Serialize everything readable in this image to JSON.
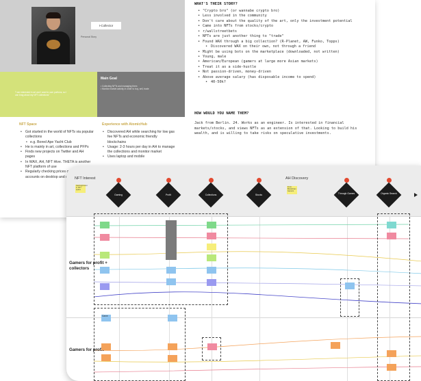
{
  "persona": {
    "name_field": "I-Collector",
    "name_tag": "Personal Story",
    "quote": "\"I am interested in art and I want to own portions, so I can brag about my NFT collections\"",
    "main_goal": {
      "title": "Main Goal",
      "items": [
        "Collecting NFTs and managing them",
        "Monitor market activity in order to buy, sell, trade"
      ]
    },
    "nft_space": {
      "title": "NFT Space",
      "items": [
        {
          "text": "Got started in the world of NFTs via popular collections",
          "sub": false
        },
        {
          "text": "e.g. Bored Ape Yacht Club",
          "sub": true
        },
        {
          "text": "He is mainly in art, collections and PFPs",
          "sub": false
        },
        {
          "text": "Finds new projects on Twitter and AH pages",
          "sub": false
        },
        {
          "text": "In WAX, AH, NFT Hive. THETA is another NFT platform of use",
          "sub": false
        },
        {
          "text": "Regularly checking prices on different accounts on desktop and mobile",
          "sub": false
        }
      ]
    },
    "experience": {
      "title": "Experience with AtomicHub",
      "items": [
        "Discovered AH while searching for low gas fee NFTs and economic friendly blockchains",
        "Usage: 2-3 hours per day in AH to manage the collections and monitor market",
        "Uses laptop and mobile"
      ]
    },
    "story": {
      "title": "WHAT'S THEIR STORY?",
      "items": [
        {
          "text": "\"Crypto bro\" (or wannabe crypto bro)",
          "sub": false
        },
        {
          "text": "Less involved in the community",
          "sub": false
        },
        {
          "text": "Don't care about the quality of the art, only the investment potential",
          "sub": false
        },
        {
          "text": "Came into NFTs from stocks/crypto",
          "sub": false
        },
        {
          "text": "r/wallstreetbets",
          "sub": false
        },
        {
          "text": "NFTs are just another thing to \"trade\"",
          "sub": false
        },
        {
          "text": "Found WAX through a big collection? (R-Planet, AW, Funko, Topps)",
          "sub": false
        },
        {
          "text": "Discovered WAX on their own, not through a friend",
          "sub": true
        },
        {
          "text": "Might be using bots on the marketplace (downloaded, not written)",
          "sub": false
        },
        {
          "text": "Young, male",
          "sub": false
        },
        {
          "text": "American/European (gamers at large more Asian markets)",
          "sub": false
        },
        {
          "text": "Treat it as a side-hustle",
          "sub": false
        },
        {
          "text": "Not passion-driven, money-driven",
          "sub": false
        },
        {
          "text": "Above average salary (has disposable income to spend)",
          "sub": false
        },
        {
          "text": "40-50k?",
          "sub": true
        }
      ]
    },
    "name_question": {
      "title": "HOW WOULD YOU NAME THEM?",
      "text": "Jack from Berlin. 24. Works as an engineer. Is interested in financial markets/stocks, and views NFTs as an extension of that. Looking to build his wealth, and is willing to take risks on speculative investments."
    }
  },
  "board": {
    "header_labels": {
      "nft_interest": "NFT Interest",
      "ah_discovery": "AH Discovery"
    },
    "stages": [
      "Gaming",
      "Profit",
      "Collections",
      "Stocks",
      "Through Games",
      "Organic Search"
    ],
    "sticky_notes": [
      "Gaming/invest in NFT space",
      "From Blockchain Gamers",
      "Nav to something"
    ],
    "rows": [
      "Gamers for profit + collectors",
      "Gamers for profit"
    ],
    "game_label": "Game",
    "sticky_colors": {
      "green": "#7fd98a",
      "pink": "#f08aa0",
      "yellow": "#f6ee7a",
      "blue": "#8fc4ef",
      "purple": "#9a9af0",
      "orange": "#f4a25a",
      "teal": "#7fd9d0"
    }
  }
}
